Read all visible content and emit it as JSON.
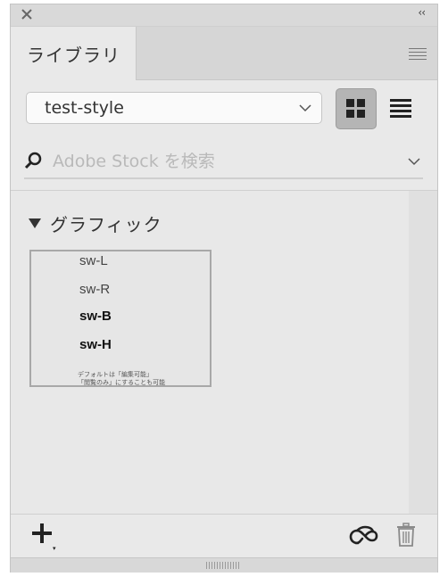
{
  "header": {
    "close_icon": "close-icon",
    "collapse_label": "‹‹",
    "menu_icon": "panel-menu-icon"
  },
  "tabs": [
    {
      "label": "ライブラリ",
      "active": true
    }
  ],
  "library_select": {
    "value": "test-style",
    "icon": "chevron-down-icon"
  },
  "view_toggle": {
    "grid_icon": "grid-view-icon",
    "list_icon": "list-view-icon",
    "selected": "grid"
  },
  "search": {
    "placeholder": "Adobe Stock を検索",
    "icon": "search-icon",
    "dropdown_icon": "chevron-down-icon"
  },
  "section": {
    "title": "グラフィック",
    "expanded": true
  },
  "thumbnail": {
    "lines_light": [
      "sw-L",
      "sw-R"
    ],
    "lines_bold": [
      "sw-B",
      "sw-H"
    ],
    "note_lines": [
      "デフォルトは「編集可能」",
      "「閲覧のみ」にすることも可能"
    ]
  },
  "footer": {
    "add_icon": "add-icon",
    "creative_cloud_icon": "creative-cloud-icon",
    "delete_icon": "trash-icon"
  },
  "colors": {
    "panel_bg": "#e9e9e9",
    "selected_toggle": "#b5b5b5"
  }
}
